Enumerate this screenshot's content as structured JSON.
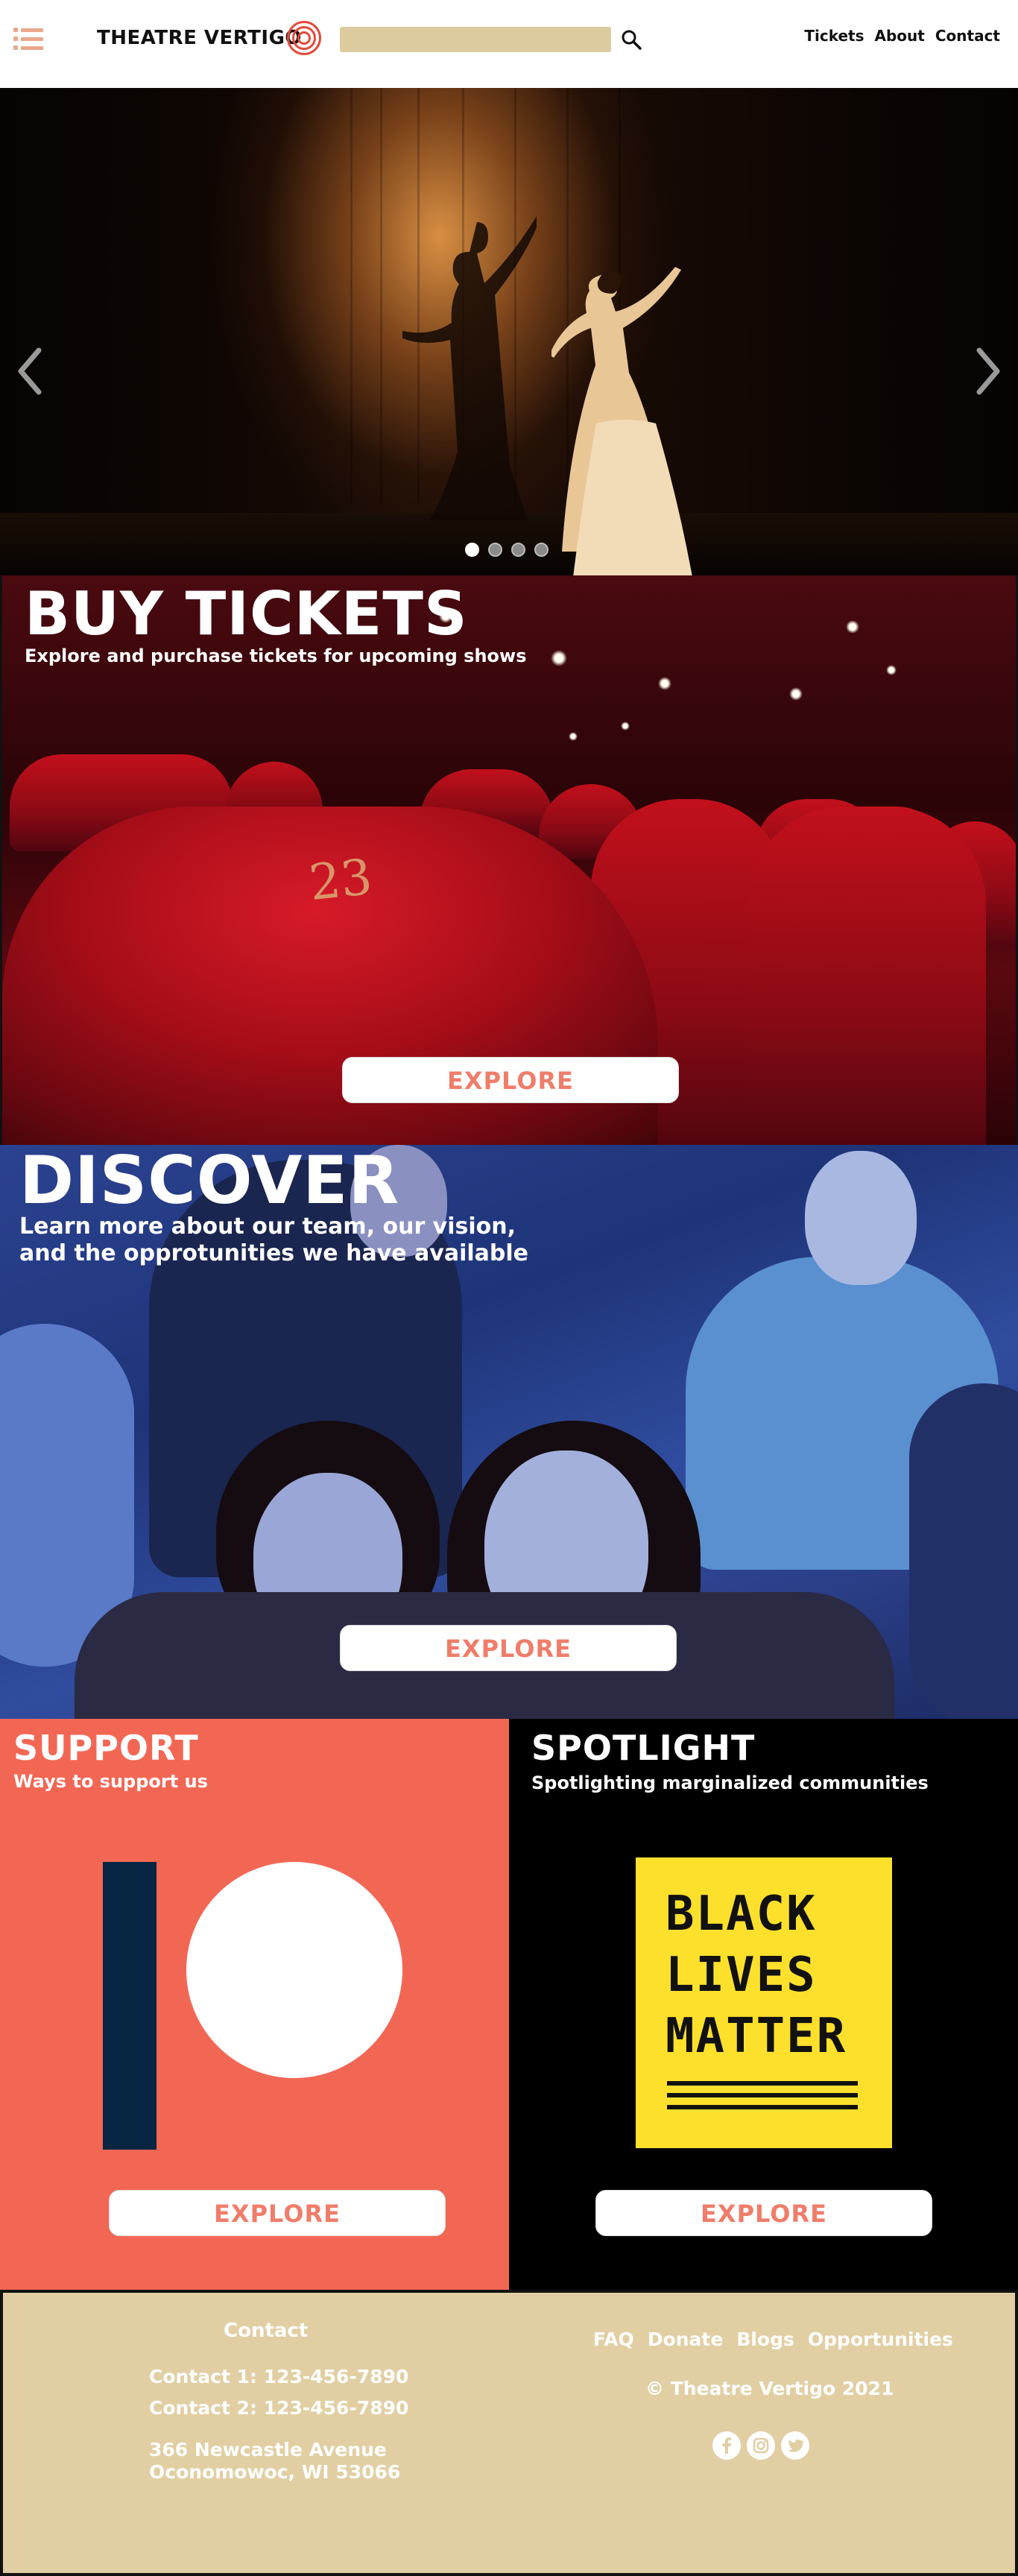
{
  "header": {
    "logo_text": "THEATRE VERTIGO",
    "search": {
      "value": "",
      "placeholder": ""
    },
    "nav": [
      "Tickets",
      "About",
      "Contact"
    ]
  },
  "hero": {
    "slides_total": 4,
    "active_slide": 1
  },
  "tickets_section": {
    "title": "BUY TICKETS",
    "subtitle": "Explore and purchase tickets for upcoming shows",
    "seat_number": "23",
    "button": "EXPLORE"
  },
  "discover_section": {
    "title": "DISCOVER",
    "subtitle_line1": "Learn more about our team, our vision,",
    "subtitle_line2": "and the opprotunities we have available",
    "button": "EXPLORE"
  },
  "support_section": {
    "title": "SUPPORT",
    "subtitle": "Ways to support us",
    "button": "EXPLORE"
  },
  "spotlight_section": {
    "title": "SPOTLIGHT",
    "subtitle": "Spotlighting marginalized communities",
    "poster_lines": [
      "BLACK",
      "LIVES",
      "MATTER"
    ],
    "button": "EXPLORE"
  },
  "footer": {
    "contact_heading": "Contact",
    "contact1": "Contact 1: 123-456-7890",
    "contact2": "Contact 2: 123-456-7890",
    "address_line1": "366 Newcastle Avenue",
    "address_line2": "Oconomowoc, WI 53066",
    "links": [
      "FAQ",
      "Donate",
      "Blogs",
      "Opportunities"
    ],
    "copyright": "© Theatre Vertigo 2021",
    "social_icons": [
      "facebook-icon",
      "instagram-icon",
      "twitter-icon"
    ]
  },
  "colors": {
    "accent": "#ef7d6a",
    "search_bg": "#dbcb9e",
    "support_bg": "#f26754",
    "patreon_navy": "#062642",
    "blm_yellow": "#fde02c",
    "footer_bg": "#e1cfa3"
  }
}
